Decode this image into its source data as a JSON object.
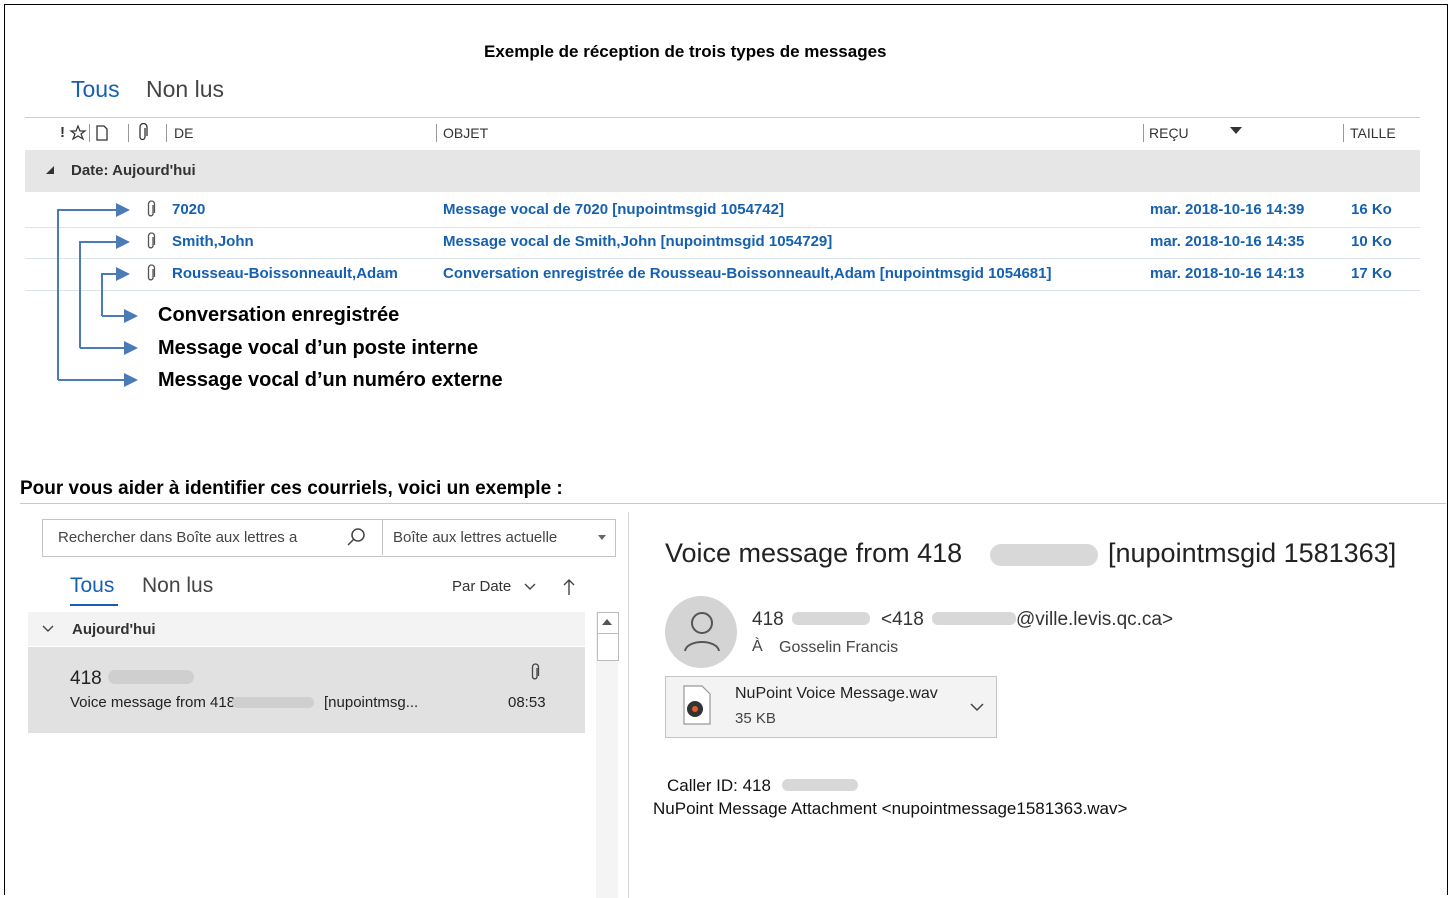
{
  "top": {
    "caption": "Exemple de réception de trois types de messages",
    "tabs": [
      "Tous",
      "Non lus"
    ],
    "columns": {
      "importance": "!",
      "de": "DE",
      "objet": "OBJET",
      "recu": "REÇU",
      "taille": "TAILLE"
    },
    "group_label": "Date: Aujourd'hui",
    "rows": [
      {
        "from": "7020",
        "subject": "Message vocal de 7020 [nupointmsgid 1054742]",
        "received": "mar. 2018-10-16 14:39",
        "size": "16 Ko"
      },
      {
        "from": "Smith,John",
        "subject": "Message vocal de Smith,John [nupointmsgid 1054729]",
        "received": "mar. 2018-10-16 14:35",
        "size": "10 Ko"
      },
      {
        "from": "Rousseau-Boissonneault,Adam",
        "subject": "Conversation enregistrée de Rousseau-Boissonneault,Adam [nupointmsgid 1054681]",
        "received": "mar. 2018-10-16 14:13",
        "size": "17 Ko"
      }
    ],
    "annotations": [
      "Conversation enregistrée",
      "Message vocal d’un poste interne",
      "Message vocal d’un numéro externe"
    ]
  },
  "intro": "Pour vous aider à identifier ces courriels, voici un exemple :",
  "bottom": {
    "search_placeholder": "Rechercher dans Boîte aux lettres a",
    "scope": "Boîte aux lettres actuelle",
    "tabs": [
      "Tous",
      "Non lus"
    ],
    "sort_label": "Par Date",
    "group_label": "Aujourd'hui",
    "message": {
      "sender": "418",
      "preview_prefix": "Voice message from 418",
      "preview_suffix": "[nupointmsg...",
      "time": "08:53"
    },
    "reading": {
      "subject_prefix": "Voice message from 418",
      "subject_suffix": "[nupointmsgid 1581363]",
      "from_prefix": "418",
      "from_mid": "<418",
      "from_suffix": "@ville.levis.qc.ca>",
      "to_label": "À",
      "to_name": "Gosselin Francis",
      "attachment_name": "NuPoint Voice Message.wav",
      "attachment_size": "35 KB",
      "body_line1": "Caller ID: 418",
      "body_line2": "NuPoint Message Attachment <nupointmessage1581363.wav>"
    }
  },
  "colors": {
    "accent": "#1560b0",
    "arrow": "#4a7ab8",
    "group_bg": "#e6e6e6",
    "selected_bg": "#e1e1e1"
  }
}
